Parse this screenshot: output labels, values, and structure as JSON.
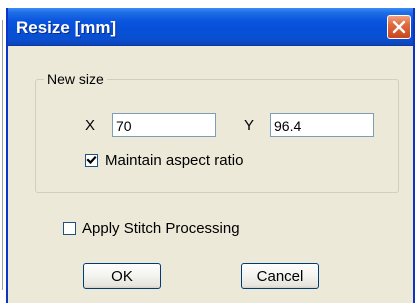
{
  "dialog": {
    "title": "Resize [mm]"
  },
  "new_size": {
    "group_label": "New size",
    "x_label": "X",
    "x_value": "70",
    "y_label": "Y",
    "y_value": "96.4",
    "aspect_label": "Maintain aspect ratio",
    "aspect_checked": true
  },
  "stitch": {
    "label": "Apply Stitch Processing",
    "checked": false
  },
  "buttons": {
    "ok": "OK",
    "cancel": "Cancel"
  },
  "icons": {
    "close": "close-icon",
    "check": "checkmark-icon"
  },
  "colors": {
    "titlebar": "#0a55df",
    "close_button": "#e06a3c",
    "dialog_bg": "#ece9d8",
    "field_border": "#7f9db9"
  }
}
